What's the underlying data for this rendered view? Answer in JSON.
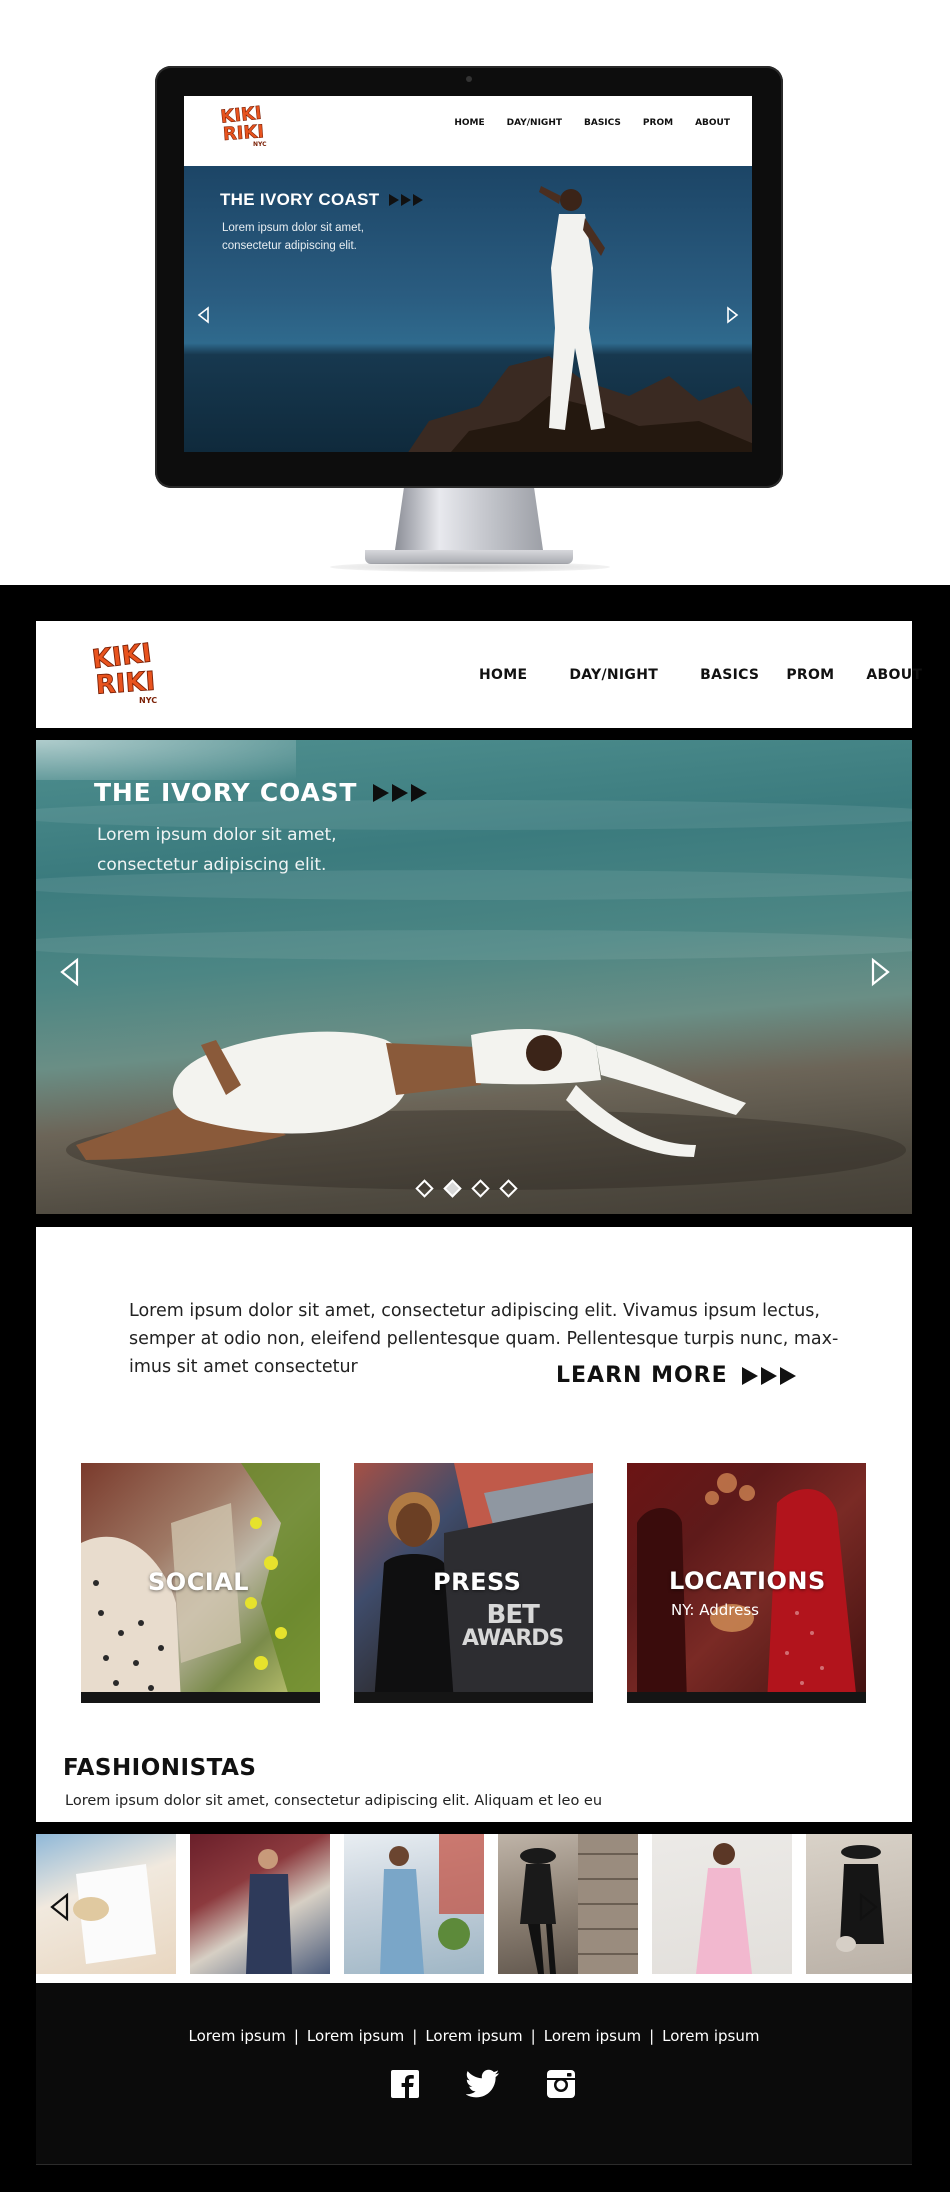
{
  "logo": {
    "line1": "KIKI",
    "line2": "RIKI",
    "tag": "NYC",
    "color": "#e8531e"
  },
  "nav": {
    "home": "HOME",
    "daynight": "DAY/NIGHT",
    "basics": "BASICS",
    "prom": "PROM",
    "about": "ABOUT"
  },
  "mockup": {
    "hero_title": "THE IVORY COAST",
    "hero_sub_line1": "Lorem ipsum dolor sit amet,",
    "hero_sub_line2": "consectetur adipiscing elit."
  },
  "hero": {
    "title": "THE IVORY COAST",
    "sub_line1": "Lorem ipsum dolor sit amet,",
    "sub_line2": "consectetur adipiscing elit.",
    "slides": 4,
    "active_slide": 2
  },
  "intro": {
    "text": "Lorem ipsum dolor sit amet, consectetur adipiscing elit. Vivamus ipsum lectus, semper at odio non, eleifend pellentesque quam. Pellentesque turpis nunc, max-imus sit amet consectetur",
    "learn_more": "LEARN MORE"
  },
  "cards": [
    {
      "title": "SOCIAL"
    },
    {
      "title": "PRESS",
      "badge_line1": "BET",
      "badge_line2": "AWARDS"
    },
    {
      "title": "LOCATIONS",
      "subtitle": "NY: Address"
    }
  ],
  "fashionistas": {
    "title": "FASHIONISTAS",
    "subtitle": "Lorem ipsum dolor sit amet, consectetur adipiscing elit. Aliquam et leo eu"
  },
  "footer": {
    "links": [
      "Lorem ipsum",
      "Lorem ipsum",
      "Lorem ipsum",
      "Lorem ipsum",
      "Lorem ipsum"
    ],
    "social": [
      "facebook-icon",
      "twitter-icon",
      "instagram-icon"
    ]
  }
}
